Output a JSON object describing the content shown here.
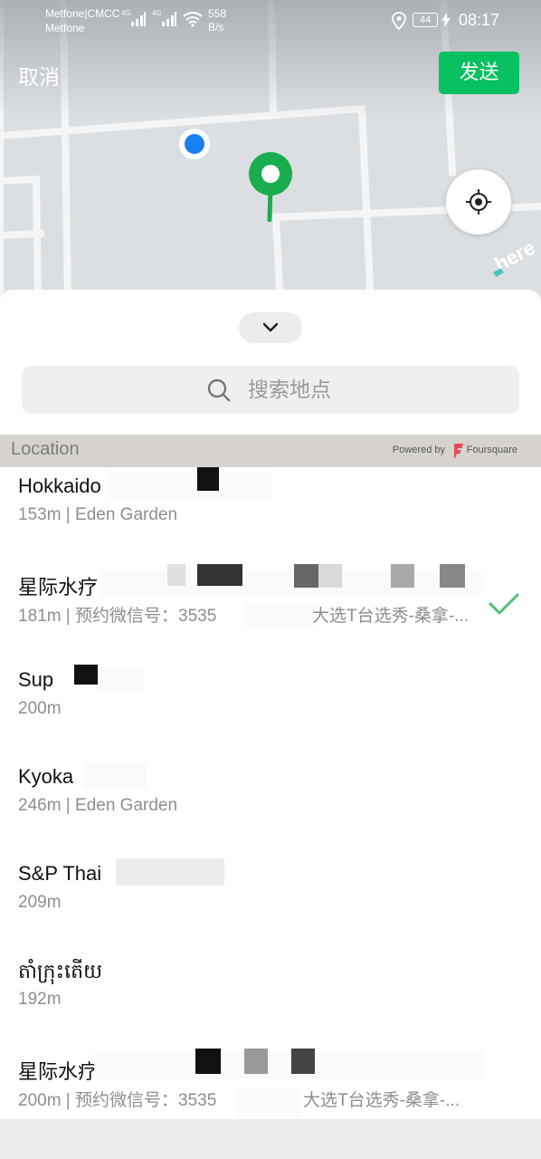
{
  "status_bar": {
    "carrier_1": "Metfone|CMCC",
    "carrier_2": "Metfone",
    "signal_1": "4G",
    "signal_2": "4G",
    "net_speed_value": "558",
    "net_speed_unit": "B/s",
    "battery": "44",
    "time": "08:17"
  },
  "header": {
    "cancel_label": "取消",
    "send_label": "发送"
  },
  "map": {
    "provider_logo": "here",
    "icons": [
      "location-pin-icon",
      "current-location-dot-icon",
      "locate-me-icon"
    ]
  },
  "sheet": {
    "collapse_icon": "chevron-down-icon",
    "search_placeholder": "搜索地点",
    "section_title": "Location",
    "powered_by": "Powered by",
    "provider": "Foursquare"
  },
  "places": [
    {
      "name": "Hokkaido",
      "sub": "153m | Eden Garden",
      "selected": false
    },
    {
      "name": "星际水疗",
      "sub": "181m | 预约微信号：3535",
      "sub_tail": "大选T台选秀-桑拿-...",
      "selected": true
    },
    {
      "name": "Sup",
      "sub": "200m",
      "selected": false
    },
    {
      "name": "Kyoka",
      "sub": "246m | Eden Garden",
      "selected": false
    },
    {
      "name": "S&P Thai",
      "sub": "209m",
      "selected": false
    },
    {
      "name": "តាំក្រុះតើយ",
      "sub": "192m",
      "selected": false
    },
    {
      "name": "星际水疗",
      "sub": "200m | 预约微信号：3535",
      "sub_tail": "大选T台选秀-桑拿-...",
      "selected": false
    }
  ],
  "colors": {
    "accent_green": "#07c160",
    "pin_green": "#1aad4f",
    "user_dot_blue": "#1a7ff0",
    "check_green": "#4dbf73"
  }
}
